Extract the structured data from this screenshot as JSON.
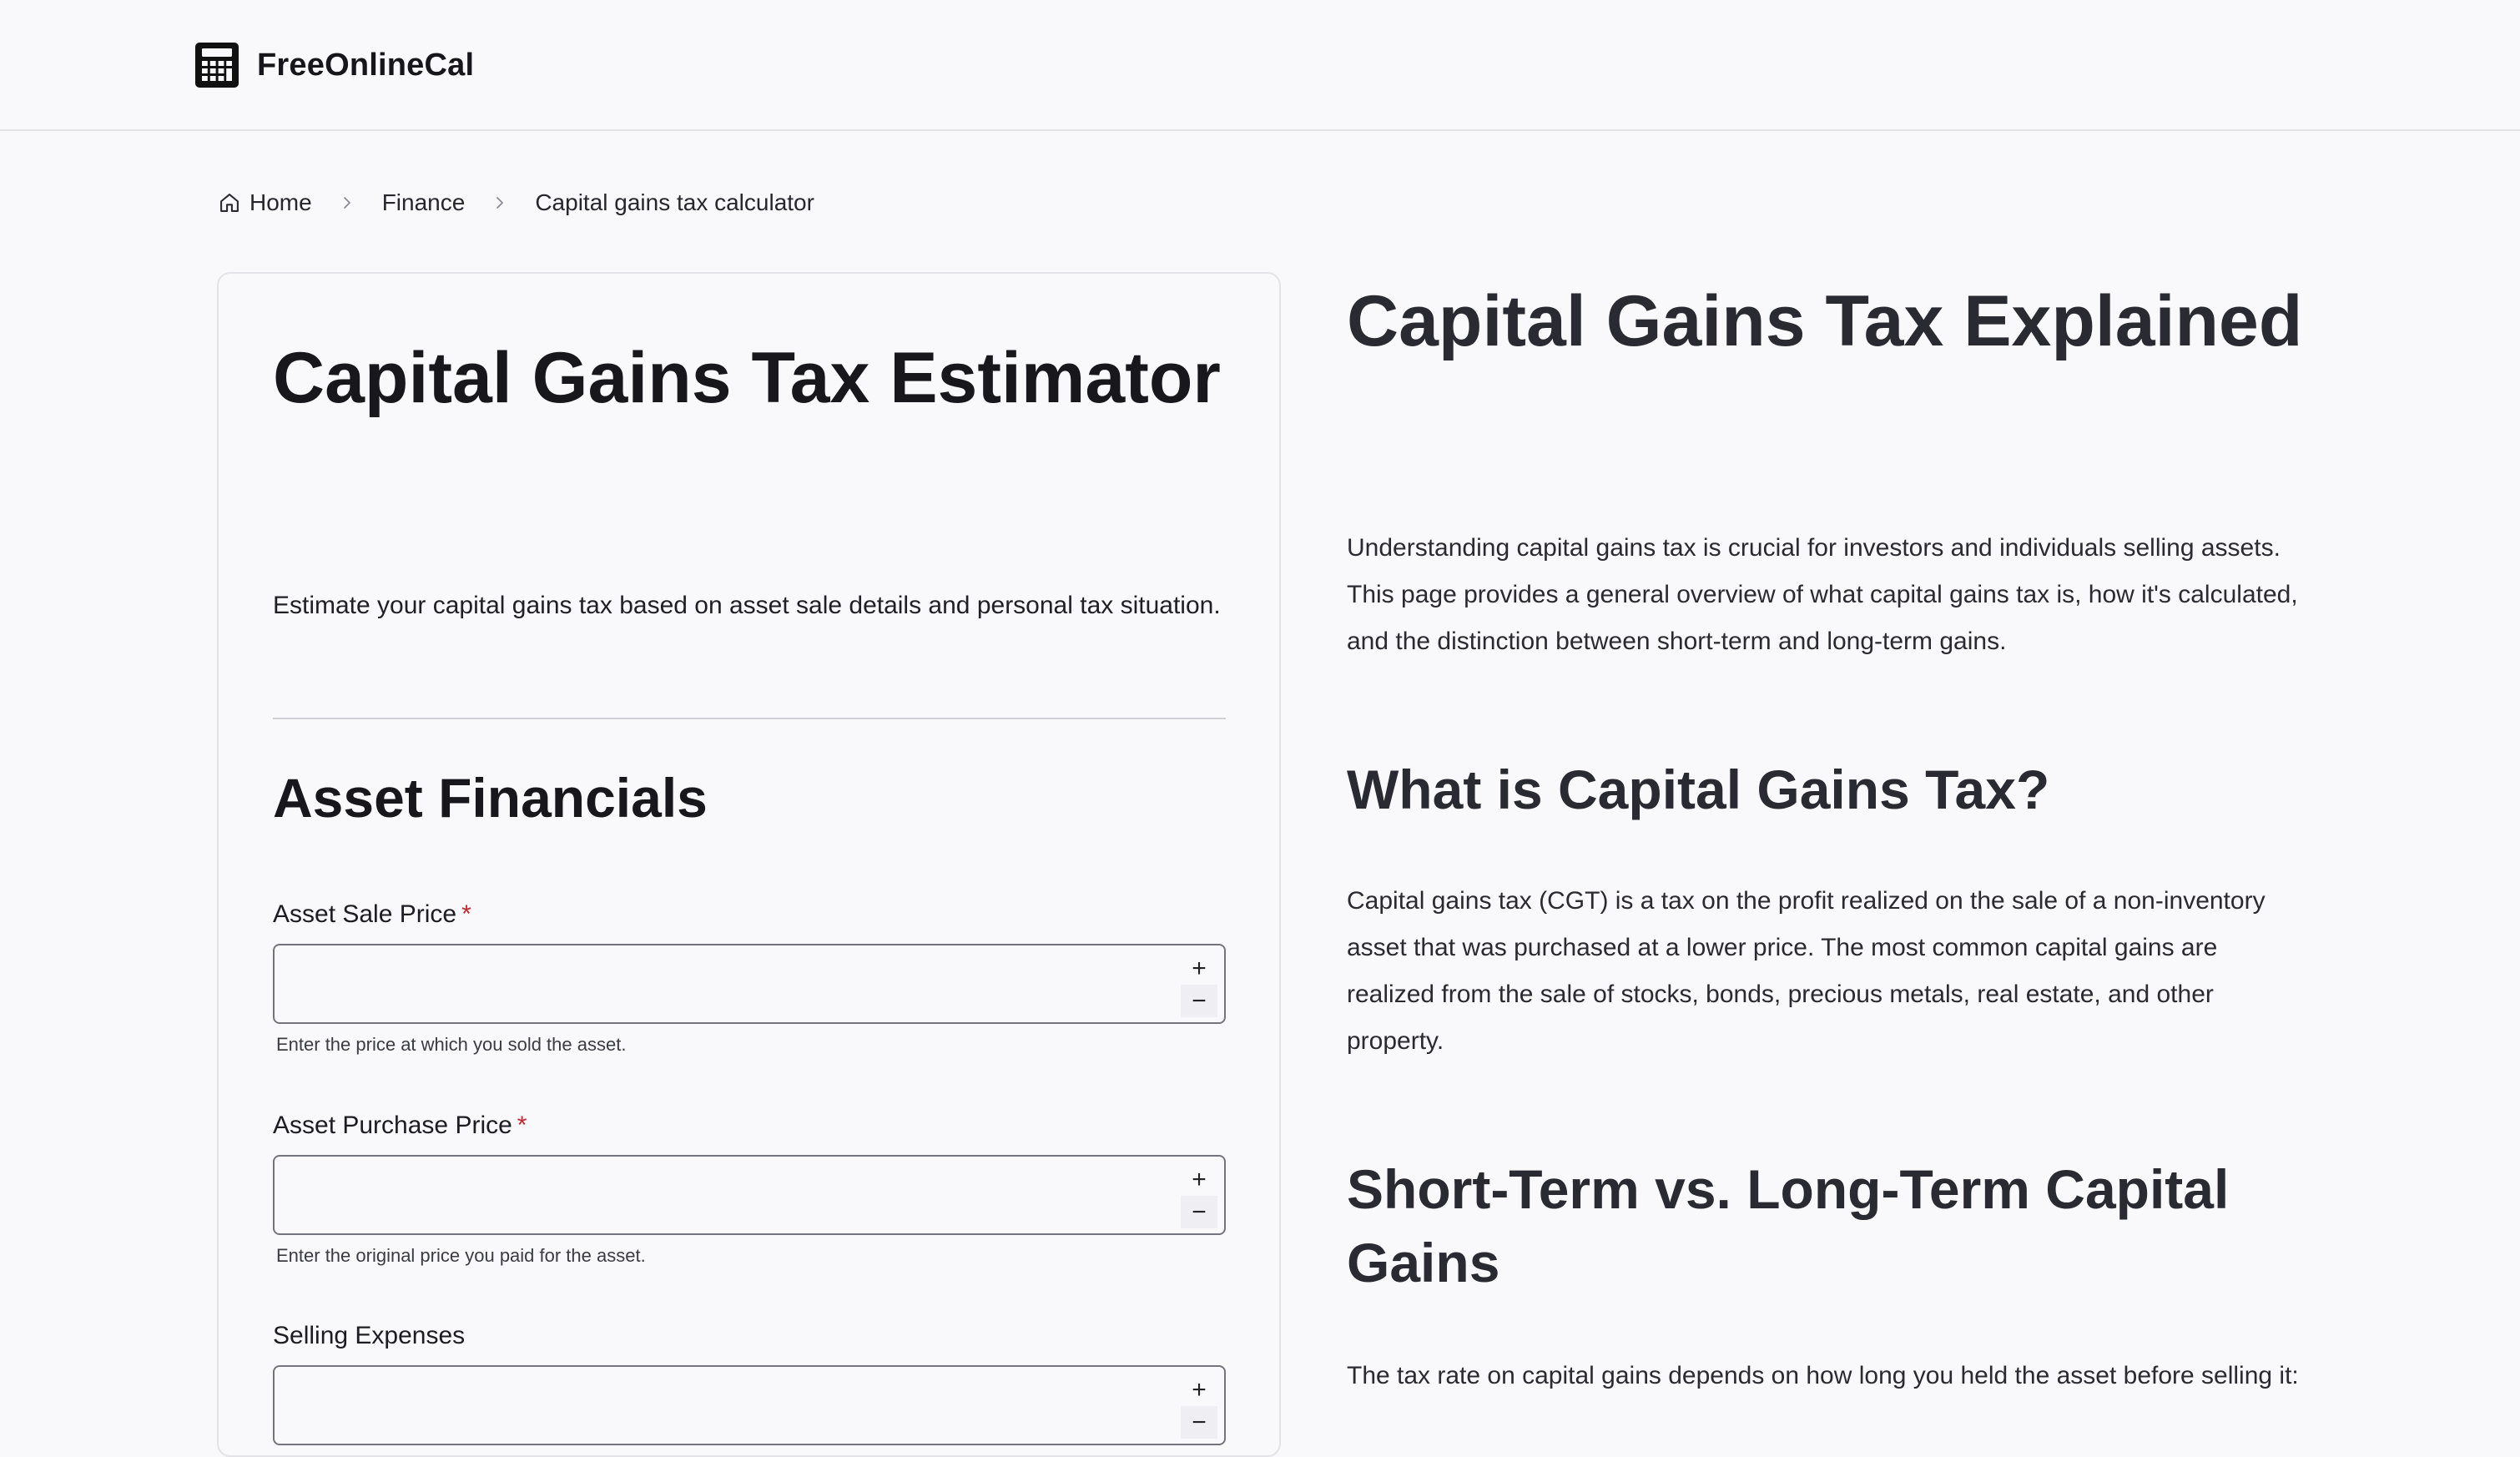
{
  "header": {
    "brand_name": "FreeOnlineCal",
    "brand_icon": "calculator-icon"
  },
  "breadcrumb": {
    "items": [
      {
        "label": "Home",
        "icon": "home-icon"
      },
      {
        "label": "Finance"
      },
      {
        "label": "Capital gains tax calculator"
      }
    ],
    "separator_icon": "chevron-right-icon"
  },
  "calculator": {
    "title": "Capital Gains Tax Estimator",
    "description": "Estimate your capital gains tax based on asset sale details and personal tax situation.",
    "section_title": "Asset Financials",
    "required_mark": "*",
    "fields": [
      {
        "label": "Asset Sale Price",
        "required": true,
        "value": "",
        "help": "Enter the price at which you sold the asset.",
        "increment": "+",
        "decrement": "−"
      },
      {
        "label": "Asset Purchase Price",
        "required": true,
        "value": "",
        "help": "Enter the original price you paid for the asset.",
        "increment": "+",
        "decrement": "−"
      },
      {
        "label": "Selling Expenses",
        "required": false,
        "value": "",
        "help": "",
        "increment": "+",
        "decrement": "−"
      }
    ]
  },
  "article": {
    "title": "Capital Gains Tax Explained",
    "intro": "Understanding capital gains tax is crucial for investors and individuals selling assets. This page provides a general overview of what capital gains tax is, how it's calculated, and the distinction between short-term and long-term gains.",
    "sections": [
      {
        "heading": "What is Capital Gains Tax?",
        "body": "Capital gains tax (CGT) is a tax on the profit realized on the sale of a non-inventory asset that was purchased at a lower price. The most common capital gains are realized from the sale of stocks, bonds, precious metals, real estate, and other property."
      },
      {
        "heading": "Short-Term vs. Long-Term Capital Gains",
        "body": "The tax rate on capital gains depends on how long you held the asset before selling it:"
      }
    ]
  },
  "colors": {
    "background": "#f9f9fc",
    "required": "#c0262d",
    "border": "#e3e3e8",
    "heading": "#17171c"
  }
}
